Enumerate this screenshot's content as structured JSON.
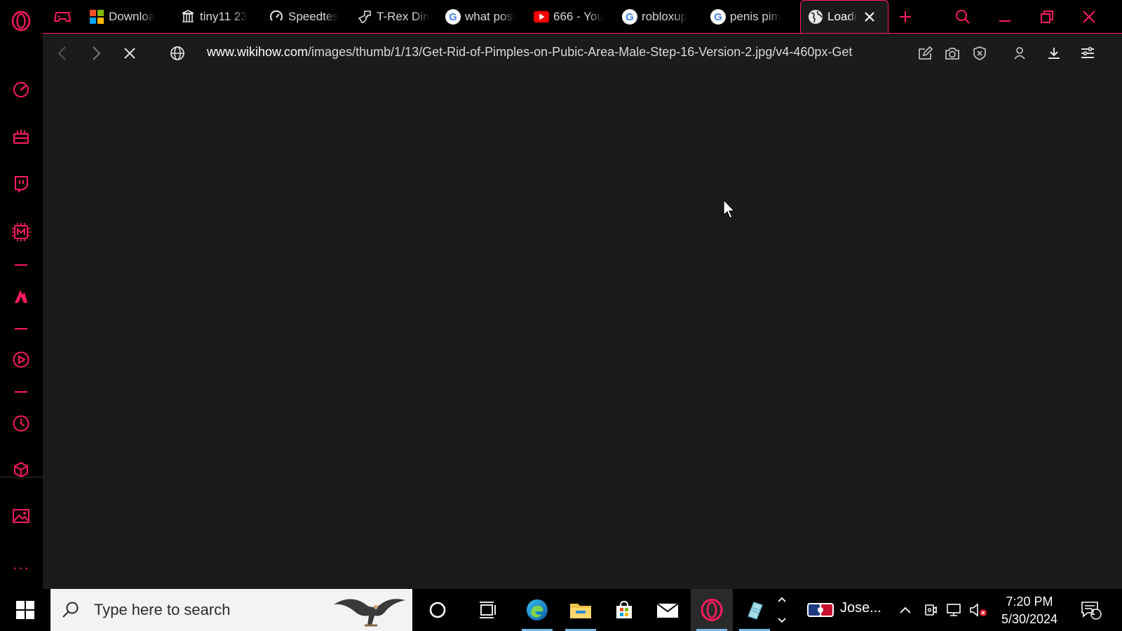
{
  "browser": {
    "name": "Opera GX",
    "accent_color": "#ff1b5e"
  },
  "sidebar": {
    "items": [
      {
        "icon": "speedometer-icon"
      },
      {
        "icon": "gx-corner-icon"
      },
      {
        "icon": "twitch-icon"
      },
      {
        "icon": "gx-control-icon"
      },
      {
        "icon": "flame-icon"
      },
      {
        "icon": "player-icon"
      },
      {
        "icon": "history-icon"
      },
      {
        "icon": "extensions-box-icon"
      },
      {
        "icon": "wallpaper-icon"
      }
    ],
    "more_label": "···"
  },
  "tabs": [
    {
      "label": "Downloa",
      "icon": "microsoft-logo"
    },
    {
      "label": "tiny11 23",
      "icon": "archive-icon"
    },
    {
      "label": "Speedtes",
      "icon": "speedtest-icon"
    },
    {
      "label": "T-Rex Din",
      "icon": "trex-icon"
    },
    {
      "label": "what posi",
      "icon": "google-icon"
    },
    {
      "label": "666 - You",
      "icon": "youtube-icon"
    },
    {
      "label": "robloxup",
      "icon": "google-icon"
    },
    {
      "label": "penis pim",
      "icon": "google-icon"
    },
    {
      "label": "Loadi",
      "icon": "globe-icon",
      "active": true
    }
  ],
  "address_bar": {
    "url_host": "www.wikihow.com",
    "url_path": "/images/thumb/1/13/Get-Rid-of-Pimples-on-Pubic-Area-Male-Step-16-Version-2.jpg/v4-460px-Get"
  },
  "taskbar": {
    "search_placeholder": "Type here to search",
    "user_label": "Jose...",
    "time": "7:20 PM",
    "date": "5/30/2024",
    "notification_count": "1"
  }
}
